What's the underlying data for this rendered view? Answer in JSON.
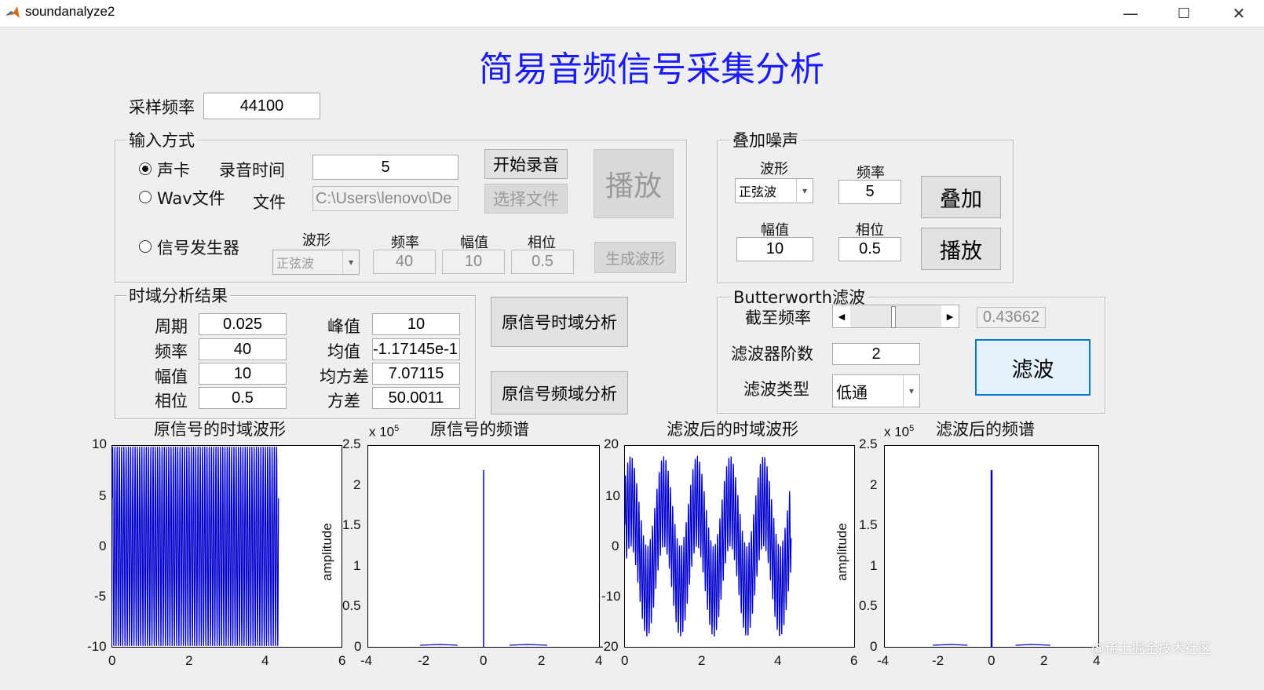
{
  "window": {
    "title": "soundanalyze2",
    "min": "—",
    "max": "☐",
    "close": "✕"
  },
  "main_title": "简易音频信号采集分析",
  "sampling": {
    "label": "采样频率",
    "value": "44100"
  },
  "input": {
    "group_title": "输入方式",
    "soundcard_label": "声卡",
    "record_time_label": "录音时间",
    "record_time_value": "5",
    "start_record": "开始录音",
    "wav_label": "Wav文件",
    "file_label": "文件",
    "file_value": "C:\\Users\\lenovo\\De",
    "choose_file": "选择文件",
    "play": "播放",
    "generator_label": "信号发生器",
    "wave_label": "波形",
    "freq_label": "频率",
    "amp_label": "幅值",
    "phase_label": "相位",
    "wave_value": "正弦波",
    "freq_value": "40",
    "amp_value": "10",
    "phase_value": "0.5",
    "gen_wave": "生成波形"
  },
  "noise": {
    "group_title": "叠加噪声",
    "wave_label": "波形",
    "freq_label": "频率",
    "wave_value": "正弦波",
    "freq_value": "5",
    "amp_label": "幅值",
    "phase_label": "相位",
    "amp_value": "10",
    "phase_value": "0.5",
    "add": "叠加",
    "play": "播放"
  },
  "time_result": {
    "group_title": "时域分析结果",
    "period_label": "周期",
    "period": "0.025",
    "peak_label": "峰值",
    "peak": "10",
    "freq_label": "频率",
    "freq": "40",
    "mean_label": "均值",
    "mean": "-1.17145e-1",
    "amp_label": "幅值",
    "amp": "10",
    "std_label": "均方差",
    "std": "7.07115",
    "phase_label": "相位",
    "phase": "0.5",
    "var_label": "方差",
    "var": "50.0011"
  },
  "buttons": {
    "time_analysis": "原信号时域分析",
    "freq_analysis": "原信号频域分析"
  },
  "filter": {
    "group_title": "Butterworth滤波",
    "cutoff_label": "截至频率",
    "cutoff_value": "0.43662",
    "cutoff_fraction": 0.43662,
    "order_label": "滤波器阶数",
    "order_value": "2",
    "type_label": "滤波类型",
    "type_value": "低通",
    "filter_button": "滤波"
  },
  "plots": {
    "p1": {
      "title": "原信号的时域波形",
      "xticks": [
        "0",
        "2",
        "4",
        "6"
      ],
      "yticks": [
        "10",
        "5",
        "0",
        "-5",
        "-10"
      ]
    },
    "p2": {
      "title": "原信号的频谱",
      "exp": "x 10",
      "exp_sup": "5",
      "ylabel": "amplitude",
      "xticks": [
        "-4",
        "-2",
        "0",
        "2",
        "4"
      ],
      "yticks": [
        "2.5",
        "2",
        "1.5",
        "1",
        "0.5",
        "0"
      ]
    },
    "p3": {
      "title": "滤波后的时域波形",
      "xticks": [
        "0",
        "2",
        "4",
        "6"
      ],
      "yticks": [
        "20",
        "10",
        "0",
        "-10",
        "-20"
      ]
    },
    "p4": {
      "title": "滤波后的频谱",
      "exp": "x 10",
      "exp_sup": "5",
      "ylabel": "amplitude",
      "xticks": [
        "-4",
        "-2",
        "0",
        "2",
        "4"
      ],
      "yticks": [
        "2.5",
        "2",
        "1.5",
        "1",
        "0.5",
        "0"
      ]
    }
  },
  "chart_data": [
    {
      "type": "line",
      "title": "原信号的时域波形",
      "xlim": [
        0,
        6
      ],
      "ylim": [
        -10,
        10
      ],
      "series": [
        {
          "freq": 40,
          "amplitude": 10,
          "phase": 0.5,
          "x_end": 4.35
        }
      ]
    },
    {
      "type": "line",
      "title": "原信号的频谱",
      "xlim": [
        -4,
        4
      ],
      "ylim": [
        0,
        2.5
      ],
      "ylabel": "amplitude",
      "y_scale_exp": 5,
      "series": [
        {
          "x": [
            0
          ],
          "y": [
            2.2
          ]
        }
      ]
    },
    {
      "type": "line",
      "title": "滤波后的时域波形",
      "xlim": [
        0,
        6
      ],
      "ylim": [
        -20,
        20
      ],
      "series": [
        {
          "x_end": 4.35
        }
      ]
    },
    {
      "type": "line",
      "title": "滤波后的频谱",
      "xlim": [
        -4,
        4
      ],
      "ylim": [
        0,
        2.5
      ],
      "ylabel": "amplitude",
      "y_scale_exp": 5,
      "series": [
        {
          "x": [
            0
          ],
          "y": [
            2.2
          ]
        }
      ]
    }
  ],
  "watermark": "@稀土掘金技术社区",
  "colors": {
    "title": "#1a1aff",
    "plot_line": "#0000cc"
  }
}
